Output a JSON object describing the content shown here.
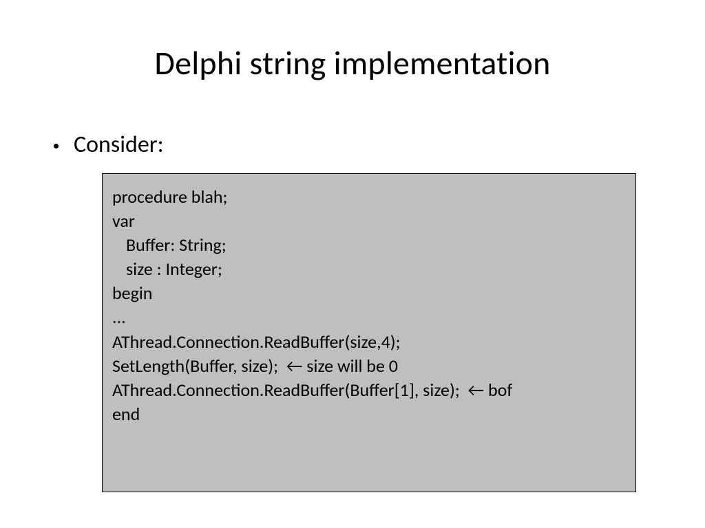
{
  "title": "Delphi string implementation",
  "bullet": "Consider:",
  "code": {
    "l1": "procedure blah;",
    "l2": "var",
    "l3": "Buffer: String;",
    "l4": "size : Integer;",
    "l5": "",
    "l6": "begin",
    "l7": "...",
    "l8": "AThread.Connection.ReadBuffer(size,4);",
    "l9": "SetLength(Buffer, size);  ← size will be 0",
    "l10": "AThread.Connection.ReadBuffer(Buffer[1], size);  ← bof",
    "l11": "end"
  }
}
